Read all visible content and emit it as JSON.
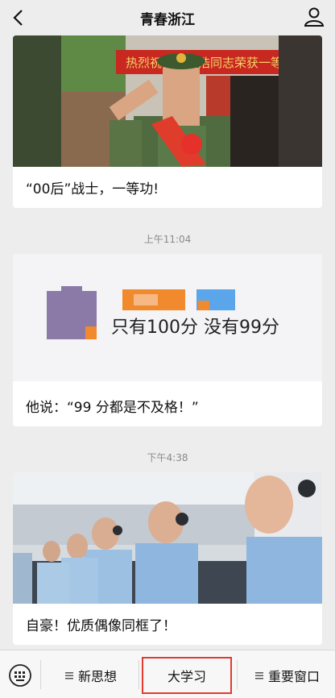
{
  "header": {
    "title": "青春浙江"
  },
  "messages": [
    {
      "caption": "“00后”战士，一等功!",
      "banner_text": "热烈祝贺王子浩同志荣获一等功"
    },
    {
      "timestamp": "上午11:04",
      "caption": "他说：“99 分都是不及格！”",
      "image_text": "只有100分 没有99分"
    },
    {
      "timestamp": "下午4:38",
      "caption": "自豪！优质偶像同框了！"
    }
  ],
  "tabbar": {
    "tabs": [
      {
        "label": "新思想"
      },
      {
        "label": "大学习"
      },
      {
        "label": "重要窗口"
      }
    ],
    "active_tab": "大学习"
  },
  "colors": {
    "active_outline": "#e23b2e",
    "background": "#ededed"
  }
}
